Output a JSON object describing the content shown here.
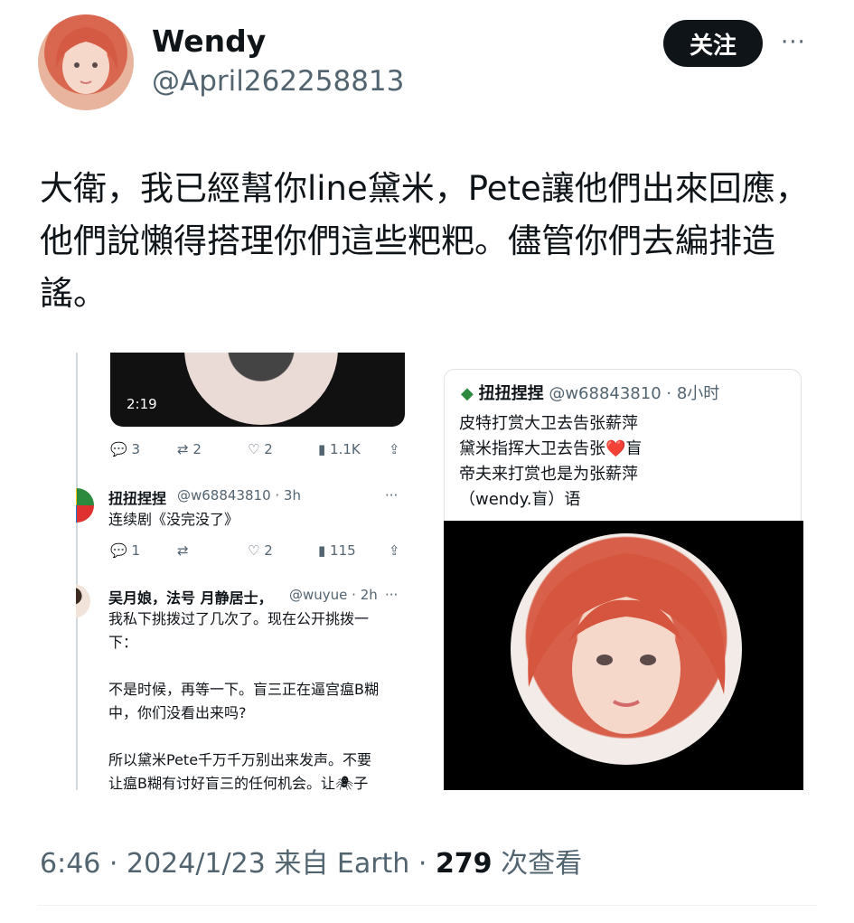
{
  "header": {
    "name": "Wendy",
    "handle": "@April262258813",
    "follow_label": "关注",
    "more_label": "···"
  },
  "tweet": {
    "text": "大衛，我已經幫你line黛米，Pete讓他們出來回應，他們說懶得搭理你們這些粑粑。儘管你們去編排造謠。"
  },
  "media": {
    "left": {
      "video_time": "2:19",
      "actions1": {
        "replies": "3",
        "retweets": "2",
        "likes": "2",
        "views": "1.1K"
      },
      "reply1": {
        "name": "扭扭捏捏",
        "handle": "@w68843810 · 3h",
        "more": "···",
        "text": "连续剧《没完没了》"
      },
      "actions2": {
        "replies": "1",
        "retweets": "",
        "likes": "2",
        "views": "115"
      },
      "reply2": {
        "name": "吴月娘，法号 月静居士，",
        "handle": "@wuyue · 2h",
        "more": "···",
        "text": "我私下挑拨过了几次了。现在公开挑拨一\n下：\n\n不是时候，再等一下。盲三正在逼宫瘟B糊\n中，你们没看出来吗?\n\n所以黛米Pete千万千万别出来发声。不要\n让瘟B糊有讨好盲三的任何机会。让🕷子\n去和🍡、🐑打成好姐妹。"
      }
    },
    "right": {
      "card_name": "扭扭捏捏",
      "card_handle": "@w68843810 · 8小时",
      "card_text": "皮特打赏大卫去告张薪萍\n黛米指挥大卫去告张❤️盲\n帝夫来打赏也是为张薪萍\n         （wendy.盲）语"
    }
  },
  "meta": {
    "time": "6:46 · 2024/1/23 来自 Earth · ",
    "views_count": "279",
    "views_label": " 次查看"
  },
  "colors": {
    "text": "#0f1419",
    "secondary": "#536471",
    "follow_bg": "#0f1419"
  }
}
